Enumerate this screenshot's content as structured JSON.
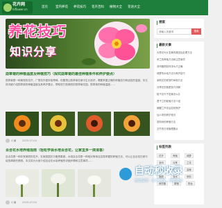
{
  "site": {
    "logo_cn": "花卉网",
    "logo_en": "hiflower.cn"
  },
  "nav": {
    "items": [
      "首页",
      "室内养花",
      "养花技巧",
      "花卉百科",
      "植物大全",
      "花语大全"
    ]
  },
  "hero": {
    "title": "养花技巧",
    "subtitle": "知识分享"
  },
  "articles": [
    {
      "title": "勋章菊的种植温度及种植技巧（探究勋章菊的最佳种植条件和养护要点）",
      "summary": "勋章菊是一种美丽的花卉，广受花卉爱好者青睐。但要想让勋章菊在家中生长良好，需要掌握正确的种植技巧和适宜的温度。本文将详细介绍勋章菊的种植温度及其养护要点，帮助您打造美丽的勋章菊花园。勋章菊的种植温度……",
      "author": "小编",
      "date": "2025-07-04"
    },
    {
      "title": "百合花水培养殖指南（轻松学会水培百合花，让家里多一抹清香）",
      "summary": "百合花是一种非常美丽的花卉，在家庭园艺中备受喜爱。水培百合花是一种相对简单且容易掌握的养殖方法，可以让百合花在家中绽放清新的美丽。本文将为大家介绍百合花水培养殖的详细步骤和注意事项……",
      "author": "小编",
      "date": "2025-07-04"
    }
  ],
  "sidebar": {
    "search": {
      "heading": "搜索",
      "placeholder": "请输入关键词",
      "button": "搜索"
    },
    "latest": {
      "heading": "最新文章",
      "items": [
        "长寿花叶片发黄的原因及处理方法",
        "吊兰的养殖方法和注意事项",
        "多肉植物如何浇水才正确",
        "绿萝的水培方法与养护技巧",
        "茉莉花的修剪时间和方法",
        "月季花的施肥技巧详解",
        "栀子花叶子发黄怎么办",
        "君子兰的繁殖方法介绍",
        "蝴蝶兰开花后如何养护",
        "仙人掌的养护常识",
        "发财树的养殖方法",
        "文竹的日常管理要点"
      ]
    },
    "tags": {
      "heading": "标签列表",
      "items": [
        "花卉",
        "养殖",
        "绿萝",
        "多肉",
        "月季",
        "兰花",
        "百合",
        "水培",
        "盆栽",
        "施肥",
        "浇水",
        "修剪",
        "病虫害",
        "繁殖",
        "阳台"
      ]
    }
  },
  "watermark": {
    "title": "自动秒收录",
    "subtitle": "自动提交 · 永不沉没 · 自动收录"
  },
  "colors": {
    "nav": "#1e7e3c",
    "accent_green": "#2a7a2a",
    "hero_pink": "#ff4fa0",
    "search_red": "#e25a5a"
  }
}
